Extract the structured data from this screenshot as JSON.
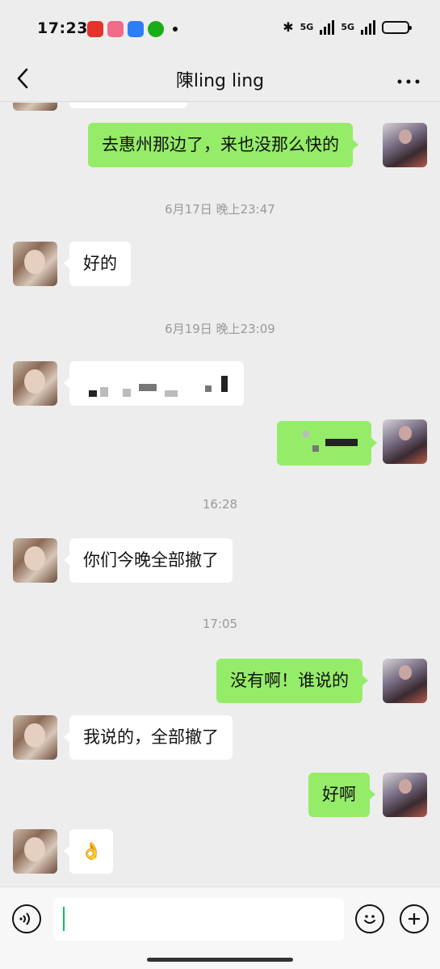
{
  "status": {
    "time": "17:23",
    "net1": "5G",
    "net2": "5G"
  },
  "header": {
    "back_icon": "chevron-left-icon",
    "title": "陳ling ling",
    "more_icon": "more-dots-icon"
  },
  "messages": [
    {
      "side": "in",
      "text": "",
      "partial": true
    },
    {
      "side": "out",
      "text": "去惠州那边了，来也没那么快的"
    },
    {
      "type": "time",
      "text": "6月17日 晚上23:47"
    },
    {
      "side": "in",
      "text": "好的"
    },
    {
      "type": "time",
      "text": "6月19日 晚上23:09"
    },
    {
      "side": "in",
      "text": "",
      "redacted": true
    },
    {
      "side": "out",
      "text": "",
      "redacted": true
    },
    {
      "type": "time",
      "text": "16:28"
    },
    {
      "side": "in",
      "text": "你们今晚全部撤了"
    },
    {
      "type": "time",
      "text": "17:05"
    },
    {
      "side": "out",
      "text": "没有啊！谁说的"
    },
    {
      "side": "in",
      "text": "我说的，全部撤了"
    },
    {
      "side": "out",
      "text": "好啊"
    },
    {
      "side": "in",
      "text": "👌"
    }
  ],
  "input": {
    "voice_icon": "voice-icon",
    "value": "",
    "emoji_icon": "emoji-icon",
    "plus_icon": "plus-icon"
  },
  "colors": {
    "outgoing_bubble": "#95ec69",
    "incoming_bubble": "#ffffff",
    "background": "#ededed",
    "cursor": "#07c160"
  }
}
